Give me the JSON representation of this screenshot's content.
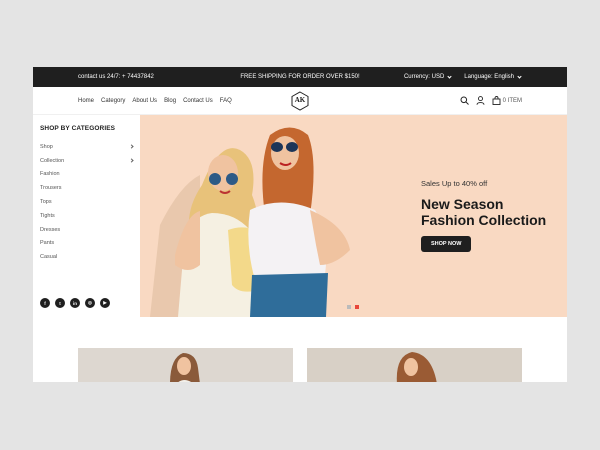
{
  "topbar": {
    "contact": "contact us 24/7: + 74437842",
    "shipping": "FREE SHIPPING FOR ORDER OVER $150!",
    "currency": "Currency: USD",
    "language": "Language: English"
  },
  "nav": {
    "menu": [
      "Home",
      "Category",
      "About Us",
      "Blog",
      "Contact Us",
      "FAQ"
    ],
    "logo": "AK",
    "cart": "0 ITEM"
  },
  "sidebar": {
    "title": "SHOP BY CATEGORIES",
    "items": [
      {
        "label": "Shop",
        "has_sub": true
      },
      {
        "label": "Collection",
        "has_sub": true
      },
      {
        "label": "Fashion",
        "has_sub": false
      },
      {
        "label": "Trousers",
        "has_sub": false
      },
      {
        "label": "Tops",
        "has_sub": false
      },
      {
        "label": "Tights",
        "has_sub": false
      },
      {
        "label": "Dresses",
        "has_sub": false
      },
      {
        "label": "Pants",
        "has_sub": false
      },
      {
        "label": "Casual",
        "has_sub": false
      }
    ],
    "social": [
      {
        "icon": "facebook-icon",
        "glyph": "f"
      },
      {
        "icon": "twitter-icon",
        "glyph": "t"
      },
      {
        "icon": "linkedin-icon",
        "glyph": "in"
      },
      {
        "icon": "instagram-icon",
        "glyph": "◎"
      },
      {
        "icon": "youtube-icon",
        "glyph": "▶"
      }
    ]
  },
  "hero": {
    "sale": "Sales Up to 40% off",
    "title_line1": "New Season",
    "title_line2": "Fashion Collection",
    "button": "SHOP NOW",
    "slides": 2,
    "active_slide": 2
  },
  "colors": {
    "accent": "#e8473b",
    "hero_bg": "#f9d9c2",
    "dark": "#1f1f1f"
  }
}
